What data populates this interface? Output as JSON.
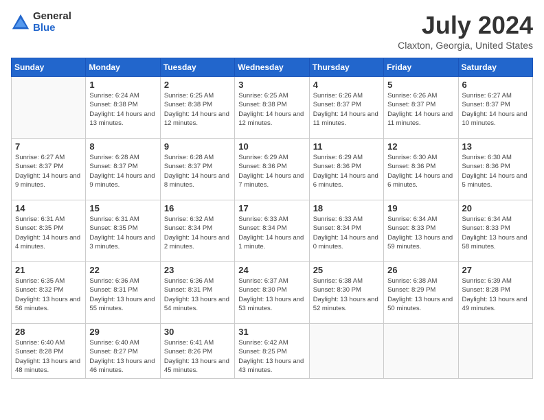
{
  "header": {
    "logo_general": "General",
    "logo_blue": "Blue",
    "month_year": "July 2024",
    "location": "Claxton, Georgia, United States"
  },
  "days_of_week": [
    "Sunday",
    "Monday",
    "Tuesday",
    "Wednesday",
    "Thursday",
    "Friday",
    "Saturday"
  ],
  "weeks": [
    [
      {
        "day": "",
        "sunrise": "",
        "sunset": "",
        "daylight": ""
      },
      {
        "day": "1",
        "sunrise": "Sunrise: 6:24 AM",
        "sunset": "Sunset: 8:38 PM",
        "daylight": "Daylight: 14 hours and 13 minutes."
      },
      {
        "day": "2",
        "sunrise": "Sunrise: 6:25 AM",
        "sunset": "Sunset: 8:38 PM",
        "daylight": "Daylight: 14 hours and 12 minutes."
      },
      {
        "day": "3",
        "sunrise": "Sunrise: 6:25 AM",
        "sunset": "Sunset: 8:38 PM",
        "daylight": "Daylight: 14 hours and 12 minutes."
      },
      {
        "day": "4",
        "sunrise": "Sunrise: 6:26 AM",
        "sunset": "Sunset: 8:37 PM",
        "daylight": "Daylight: 14 hours and 11 minutes."
      },
      {
        "day": "5",
        "sunrise": "Sunrise: 6:26 AM",
        "sunset": "Sunset: 8:37 PM",
        "daylight": "Daylight: 14 hours and 11 minutes."
      },
      {
        "day": "6",
        "sunrise": "Sunrise: 6:27 AM",
        "sunset": "Sunset: 8:37 PM",
        "daylight": "Daylight: 14 hours and 10 minutes."
      }
    ],
    [
      {
        "day": "7",
        "sunrise": "Sunrise: 6:27 AM",
        "sunset": "Sunset: 8:37 PM",
        "daylight": "Daylight: 14 hours and 9 minutes."
      },
      {
        "day": "8",
        "sunrise": "Sunrise: 6:28 AM",
        "sunset": "Sunset: 8:37 PM",
        "daylight": "Daylight: 14 hours and 9 minutes."
      },
      {
        "day": "9",
        "sunrise": "Sunrise: 6:28 AM",
        "sunset": "Sunset: 8:37 PM",
        "daylight": "Daylight: 14 hours and 8 minutes."
      },
      {
        "day": "10",
        "sunrise": "Sunrise: 6:29 AM",
        "sunset": "Sunset: 8:36 PM",
        "daylight": "Daylight: 14 hours and 7 minutes."
      },
      {
        "day": "11",
        "sunrise": "Sunrise: 6:29 AM",
        "sunset": "Sunset: 8:36 PM",
        "daylight": "Daylight: 14 hours and 6 minutes."
      },
      {
        "day": "12",
        "sunrise": "Sunrise: 6:30 AM",
        "sunset": "Sunset: 8:36 PM",
        "daylight": "Daylight: 14 hours and 6 minutes."
      },
      {
        "day": "13",
        "sunrise": "Sunrise: 6:30 AM",
        "sunset": "Sunset: 8:36 PM",
        "daylight": "Daylight: 14 hours and 5 minutes."
      }
    ],
    [
      {
        "day": "14",
        "sunrise": "Sunrise: 6:31 AM",
        "sunset": "Sunset: 8:35 PM",
        "daylight": "Daylight: 14 hours and 4 minutes."
      },
      {
        "day": "15",
        "sunrise": "Sunrise: 6:31 AM",
        "sunset": "Sunset: 8:35 PM",
        "daylight": "Daylight: 14 hours and 3 minutes."
      },
      {
        "day": "16",
        "sunrise": "Sunrise: 6:32 AM",
        "sunset": "Sunset: 8:34 PM",
        "daylight": "Daylight: 14 hours and 2 minutes."
      },
      {
        "day": "17",
        "sunrise": "Sunrise: 6:33 AM",
        "sunset": "Sunset: 8:34 PM",
        "daylight": "Daylight: 14 hours and 1 minute."
      },
      {
        "day": "18",
        "sunrise": "Sunrise: 6:33 AM",
        "sunset": "Sunset: 8:34 PM",
        "daylight": "Daylight: 14 hours and 0 minutes."
      },
      {
        "day": "19",
        "sunrise": "Sunrise: 6:34 AM",
        "sunset": "Sunset: 8:33 PM",
        "daylight": "Daylight: 13 hours and 59 minutes."
      },
      {
        "day": "20",
        "sunrise": "Sunrise: 6:34 AM",
        "sunset": "Sunset: 8:33 PM",
        "daylight": "Daylight: 13 hours and 58 minutes."
      }
    ],
    [
      {
        "day": "21",
        "sunrise": "Sunrise: 6:35 AM",
        "sunset": "Sunset: 8:32 PM",
        "daylight": "Daylight: 13 hours and 56 minutes."
      },
      {
        "day": "22",
        "sunrise": "Sunrise: 6:36 AM",
        "sunset": "Sunset: 8:31 PM",
        "daylight": "Daylight: 13 hours and 55 minutes."
      },
      {
        "day": "23",
        "sunrise": "Sunrise: 6:36 AM",
        "sunset": "Sunset: 8:31 PM",
        "daylight": "Daylight: 13 hours and 54 minutes."
      },
      {
        "day": "24",
        "sunrise": "Sunrise: 6:37 AM",
        "sunset": "Sunset: 8:30 PM",
        "daylight": "Daylight: 13 hours and 53 minutes."
      },
      {
        "day": "25",
        "sunrise": "Sunrise: 6:38 AM",
        "sunset": "Sunset: 8:30 PM",
        "daylight": "Daylight: 13 hours and 52 minutes."
      },
      {
        "day": "26",
        "sunrise": "Sunrise: 6:38 AM",
        "sunset": "Sunset: 8:29 PM",
        "daylight": "Daylight: 13 hours and 50 minutes."
      },
      {
        "day": "27",
        "sunrise": "Sunrise: 6:39 AM",
        "sunset": "Sunset: 8:28 PM",
        "daylight": "Daylight: 13 hours and 49 minutes."
      }
    ],
    [
      {
        "day": "28",
        "sunrise": "Sunrise: 6:40 AM",
        "sunset": "Sunset: 8:28 PM",
        "daylight": "Daylight: 13 hours and 48 minutes."
      },
      {
        "day": "29",
        "sunrise": "Sunrise: 6:40 AM",
        "sunset": "Sunset: 8:27 PM",
        "daylight": "Daylight: 13 hours and 46 minutes."
      },
      {
        "day": "30",
        "sunrise": "Sunrise: 6:41 AM",
        "sunset": "Sunset: 8:26 PM",
        "daylight": "Daylight: 13 hours and 45 minutes."
      },
      {
        "day": "31",
        "sunrise": "Sunrise: 6:42 AM",
        "sunset": "Sunset: 8:25 PM",
        "daylight": "Daylight: 13 hours and 43 minutes."
      },
      {
        "day": "",
        "sunrise": "",
        "sunset": "",
        "daylight": ""
      },
      {
        "day": "",
        "sunrise": "",
        "sunset": "",
        "daylight": ""
      },
      {
        "day": "",
        "sunrise": "",
        "sunset": "",
        "daylight": ""
      }
    ]
  ]
}
